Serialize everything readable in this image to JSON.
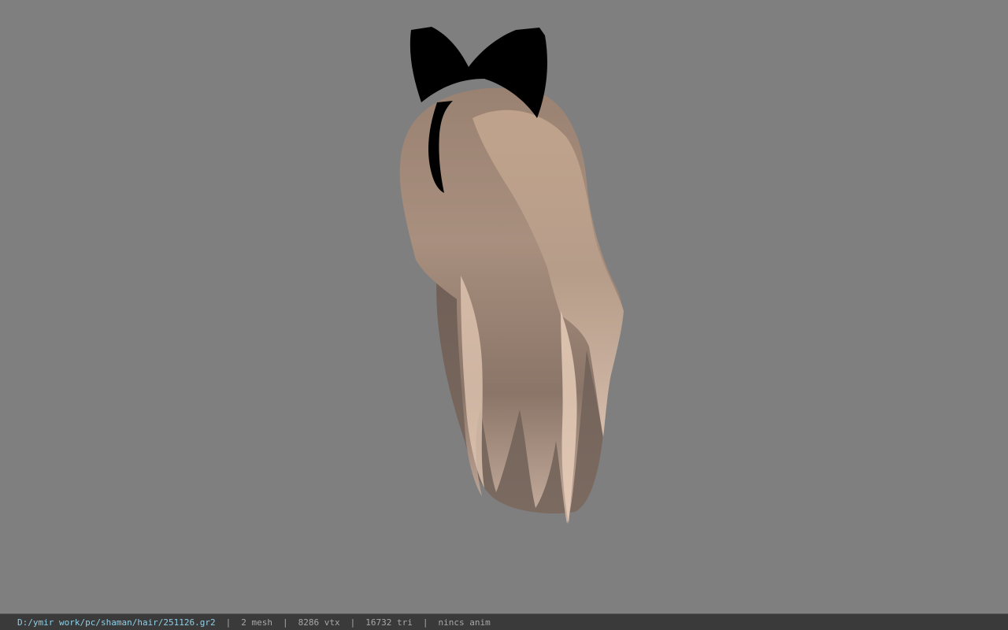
{
  "viewport": {
    "background_color": "#7f7f7f",
    "model": "hair-with-black-bow"
  },
  "statusbar": {
    "file_path": "D:/ymir work/pc/shaman/hair/251126.gr2",
    "separator": "|",
    "mesh_count": "2 mesh",
    "vertex_count": "8286 vtx",
    "triangle_count": "16732 tri",
    "anim_status": "nincs anim",
    "path_color": "#8fd0e8",
    "text_color": "#a8a8a8"
  }
}
